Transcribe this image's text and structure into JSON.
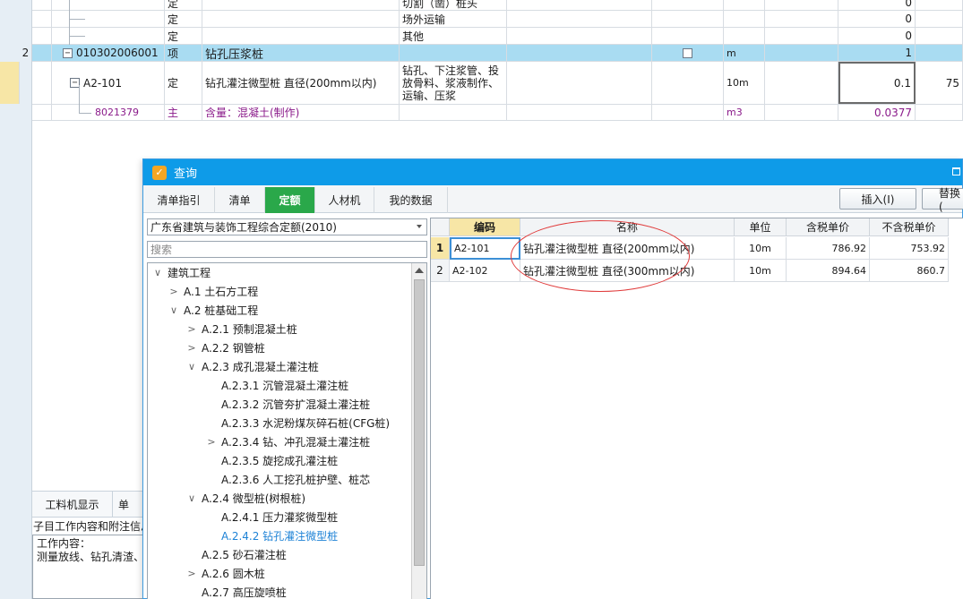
{
  "background_rows": [
    {
      "type": "定",
      "name": "",
      "desc": "切割（凿）桩头",
      "qty": "0"
    },
    {
      "type": "定",
      "name": "",
      "desc": "场外运输",
      "qty": "0"
    },
    {
      "type": "定",
      "name": "",
      "desc": "其他",
      "qty": "0"
    }
  ],
  "item_row": {
    "index": "2",
    "code": "010302006001",
    "type": "项",
    "name": "钻孔压浆桩",
    "unit": "m",
    "qty": "1",
    "expander": "−"
  },
  "quota_row": {
    "code": "A2-101",
    "type": "定",
    "name": "钻孔灌注微型桩 直径(200mm以内)",
    "desc_lines": [
      "钻孔、下注浆管、投",
      "放骨料、浆液制作、",
      "运输、压浆"
    ],
    "unit": "10m",
    "qty": "0.1",
    "price": "75",
    "expander": "−"
  },
  "material_row": {
    "code": "8021379",
    "type": "主",
    "name": "含量：混凝土(制作)",
    "unit": "m3",
    "qty": "0.0377"
  },
  "bottom_panel": {
    "tab1": "工料机显示",
    "tab2": "单",
    "info_title": "子目工作内容和附注信息",
    "info_label": "工作内容：",
    "info_text": "测量放线、钻孔清渣、"
  },
  "dialog": {
    "title": "查询",
    "tabs": [
      "清单指引",
      "清单",
      "定额",
      "人材机",
      "我的数据"
    ],
    "active_tab": "定额",
    "insert_button": "插入(I)",
    "replace_button": "替换(",
    "quota_library": "广东省建筑与装饰工程综合定额(2010)",
    "search_placeholder": "搜索",
    "tree": [
      {
        "label": "建筑工程",
        "chevron": "∨"
      },
      {
        "label": "A.1 土石方工程",
        "chevron": ">"
      },
      {
        "label": "A.2 桩基础工程",
        "chevron": "∨"
      },
      {
        "label": "A.2.1 预制混凝土桩",
        "chevron": ">"
      },
      {
        "label": "A.2.2 钢管桩",
        "chevron": ">"
      },
      {
        "label": "A.2.3 成孔混凝土灌注桩",
        "chevron": "∨"
      },
      {
        "label": "A.2.3.1 沉管混凝土灌注桩",
        "chevron": ""
      },
      {
        "label": "A.2.3.2 沉管夯扩混凝土灌注桩",
        "chevron": ""
      },
      {
        "label": "A.2.3.3 水泥粉煤灰碎石桩(CFG桩)",
        "chevron": ""
      },
      {
        "label": "A.2.3.4 钻、冲孔混凝土灌注桩",
        "chevron": ">"
      },
      {
        "label": "A.2.3.5 旋挖成孔灌注桩",
        "chevron": ""
      },
      {
        "label": "A.2.3.6 人工挖孔桩护壁、桩芯",
        "chevron": ""
      },
      {
        "label": "A.2.4 微型桩(树根桩)",
        "chevron": "∨"
      },
      {
        "label": "A.2.4.1 压力灌浆微型桩",
        "chevron": ""
      },
      {
        "label": "A.2.4.2 钻孔灌注微型桩",
        "chevron": ""
      },
      {
        "label": "A.2.5 砂石灌注桩",
        "chevron": ""
      },
      {
        "label": "A.2.6 圆木桩",
        "chevron": ">"
      },
      {
        "label": "A.2.7 高压旋喷桩",
        "chevron": ""
      }
    ],
    "grid": {
      "headers": [
        "编码",
        "名称",
        "单位",
        "含税单价",
        "不含税单价"
      ],
      "rows": [
        {
          "index": "1",
          "code": "A2-101",
          "name": "钻孔灌注微型桩 直径(200mm以内)",
          "unit": "10m",
          "tax_price": "786.92",
          "notax_price": "753.92"
        },
        {
          "index": "2",
          "code": "A2-102",
          "name": "钻孔灌注微型桩 直径(300mm以内)",
          "unit": "10m",
          "tax_price": "894.64",
          "notax_price": "860.7"
        }
      ]
    }
  },
  "colors": {
    "accent": "#0e9be8",
    "active_tab": "#2aa84a",
    "selected_row": "#a9dcf2",
    "material_text": "#8a1a8a",
    "annotation": "#e03a3a"
  }
}
